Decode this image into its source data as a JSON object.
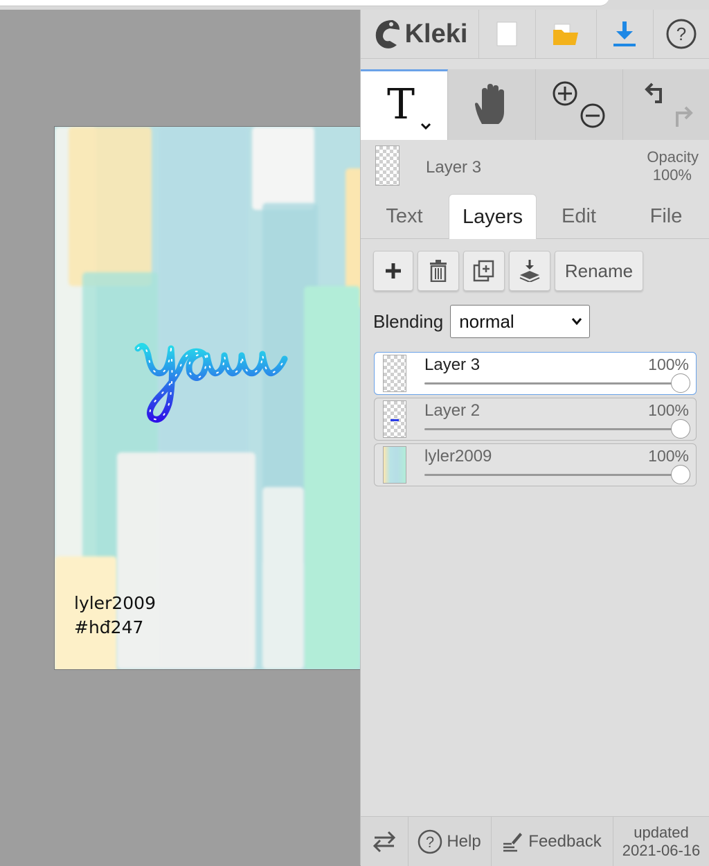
{
  "canvas": {
    "overlay_line1": "lyler2009",
    "overlay_line2": "#hđ247",
    "script_word": "you"
  },
  "header": {
    "logo": "Kleki",
    "icons": [
      "new-image-icon",
      "open-folder-icon",
      "download-icon",
      "help-circle-icon"
    ],
    "accent": "#1e88e5"
  },
  "tools": {
    "active_tool": "text-tool",
    "items": [
      "text-tool",
      "hand-tool",
      "zoom-tool",
      "undo-redo"
    ]
  },
  "layer_info": {
    "name": "Layer 3",
    "opacity_label": "Opacity",
    "opacity_value": "100%"
  },
  "tabs": [
    {
      "label": "Text",
      "active": false
    },
    {
      "label": "Layers",
      "active": true
    },
    {
      "label": "Edit",
      "active": false
    },
    {
      "label": "File",
      "active": false
    }
  ],
  "layer_buttons": {
    "rename_label": "Rename"
  },
  "blending": {
    "label": "Blending",
    "value": "normal"
  },
  "layers": [
    {
      "name": "Layer 3",
      "opacity": "100%",
      "active": true
    },
    {
      "name": "Layer 2",
      "opacity": "100%",
      "active": false
    },
    {
      "name": "lyler2009",
      "opacity": "100%",
      "active": false
    }
  ],
  "footer": {
    "help_label": "Help",
    "feedback_label": "Feedback",
    "updated_label": "updated",
    "updated_date": "2021-06-16"
  }
}
